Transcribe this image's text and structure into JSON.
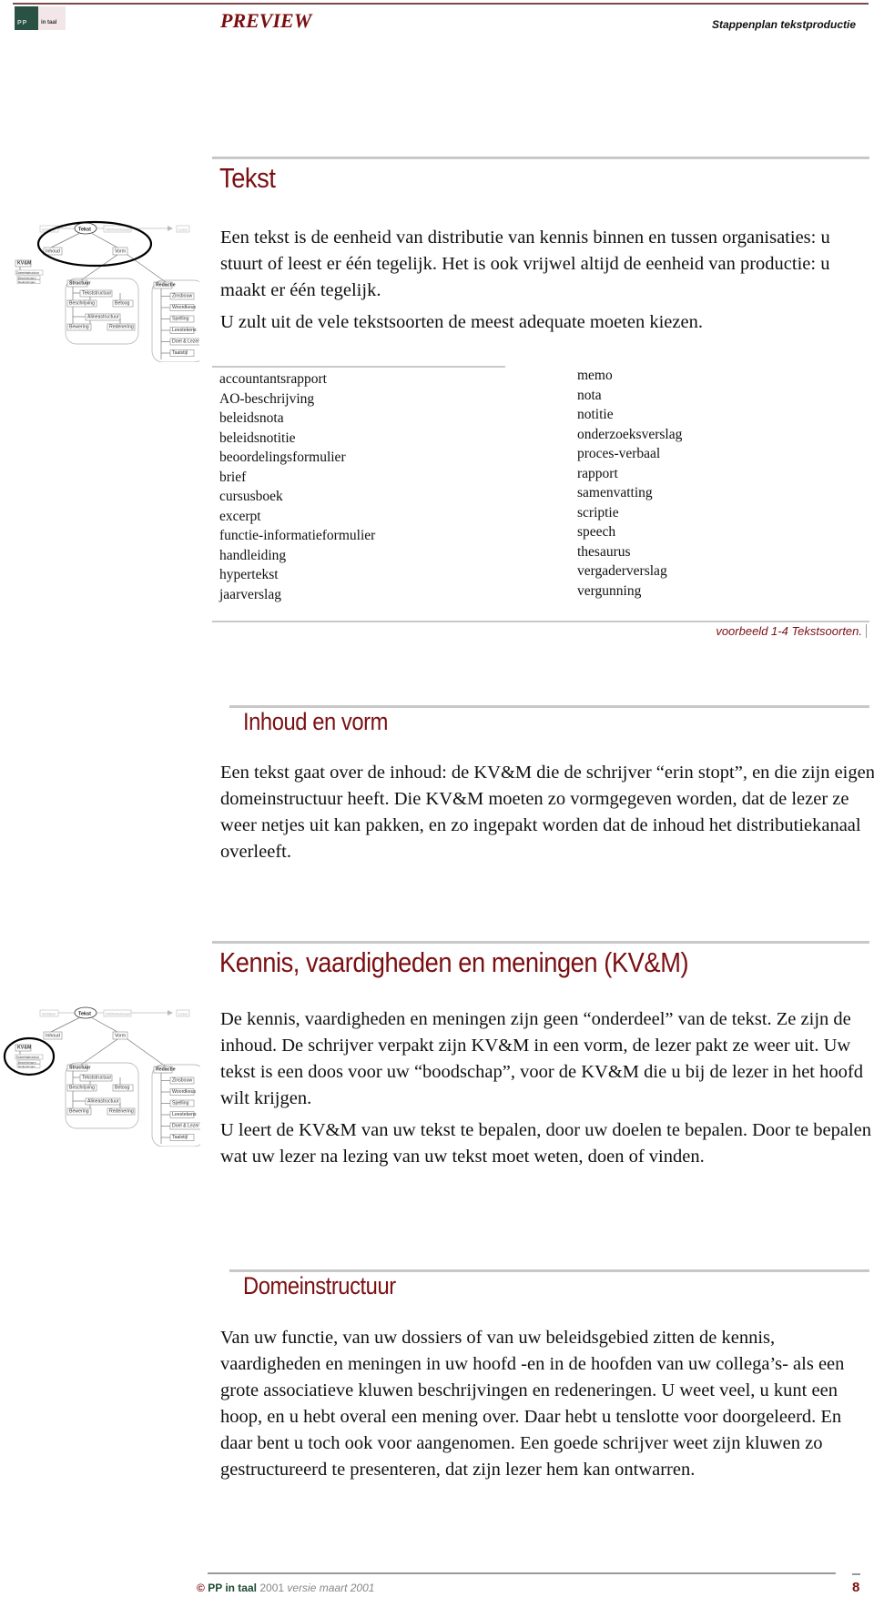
{
  "header": {
    "logo_label": "PP in taal",
    "logo_left": "PP",
    "logo_right": "in taal",
    "preview_label": "PREVIEW",
    "running_title": "Stappenplan tekstproductie"
  },
  "diagram": {
    "top_row": [
      "Schrijver",
      "Tekst",
      "Distributiekanaal",
      "Lezer"
    ],
    "inhoud": "Inhoud",
    "vorm": "Vorm",
    "kvm": "KV&M",
    "kvm_children": [
      "Domeinstructuur",
      "Beschrijvingen",
      "Redeneringen"
    ],
    "structuur": {
      "label": "Structuur",
      "items": [
        "Tekststructuur",
        "Beschrijving",
        "Betoog",
        "Alineastructuur",
        "Bewering",
        "Redenering"
      ]
    },
    "redactie": {
      "label": "Redactie",
      "items": [
        "Zinsbouw",
        "Woordkeus",
        "Spelling",
        "Leestekens",
        "Doel & Lezer",
        "Taalstijl"
      ]
    }
  },
  "sections": {
    "tekst": {
      "heading": "Tekst",
      "paragraphs": [
        "Een tekst is de eenheid van distributie van kennis binnen en tussen organisaties: u stuurt of leest er één tegelijk. Het is ook vrijwel altijd de eenheid van productie: u maakt er één tegelijk.",
        "U zult uit de vele tekstsoorten de meest adequate moeten kiezen."
      ]
    },
    "tekstsoorten": {
      "left": [
        "accountantsrapport",
        "AO-beschrijving",
        "beleidsnota",
        "beleidsnotitie",
        "beoordelingsformulier",
        "brief",
        "cursusboek",
        "excerpt",
        "functie-informatieformulier",
        "handleiding",
        "hypertekst",
        "jaarverslag"
      ],
      "right": [
        "memo",
        "nota",
        "notitie",
        "onderzoeksverslag",
        "proces-verbaal",
        "rapport",
        "samenvatting",
        "scriptie",
        "speech",
        "thesaurus",
        "vergaderverslag",
        "vergunning"
      ],
      "caption": "voorbeeld 1-4  Tekstsoorten."
    },
    "inhoud_en_vorm": {
      "heading": "Inhoud en vorm",
      "paragraphs": [
        "Een tekst gaat over de inhoud: de KV&M die de schrijver “erin stopt”, en die zijn eigen domeinstructuur heeft. Die KV&M moeten zo vormgegeven worden, dat de lezer ze weer netjes uit kan pakken, en zo ingepakt worden dat de inhoud het distributiekanaal overleeft."
      ]
    },
    "kvm": {
      "heading": "Kennis, vaardigheden en meningen (KV&M)",
      "paragraphs": [
        "De kennis, vaardigheden en meningen zijn geen “onderdeel” van de tekst. Ze zijn de inhoud. De schrijver verpakt zijn KV&M in een vorm, de lezer pakt ze weer uit. Uw tekst is een doos voor uw “boodschap”, voor de KV&M die u bij de lezer in het hoofd wilt krijgen.",
        "U leert de KV&M van uw tekst te bepalen, door uw doelen te bepalen. Door te bepalen wat uw lezer na lezing van uw tekst moet weten, doen of vinden."
      ]
    },
    "domeinstructuur": {
      "heading": "Domeinstructuur",
      "paragraphs": [
        "Van uw functie, van uw dossiers of van uw beleidsgebied zitten de kennis, vaardigheden en meningen in uw hoofd -en in de hoofden van uw collega’s- als een grote associatieve kluwen beschrijvingen en redeneringen. U weet veel, u kunt een hoop, en u hebt overal een mening over. Daar hebt u tenslotte voor doorgeleerd. En daar bent u toch ook voor aangenomen. Een goede schrijver weet zijn  kluwen zo gestructureerd te presenteren, dat zijn lezer hem kan ontwarren."
      ]
    }
  },
  "footer": {
    "copyright_symbol": "©",
    "brand": "PP in taal",
    "year": "2001",
    "version": "versie maart 2001",
    "page_number": "8"
  },
  "colors": {
    "accent": "#7a0f12",
    "rule": "#c8c8c8",
    "brand_green": "#2a5244"
  }
}
